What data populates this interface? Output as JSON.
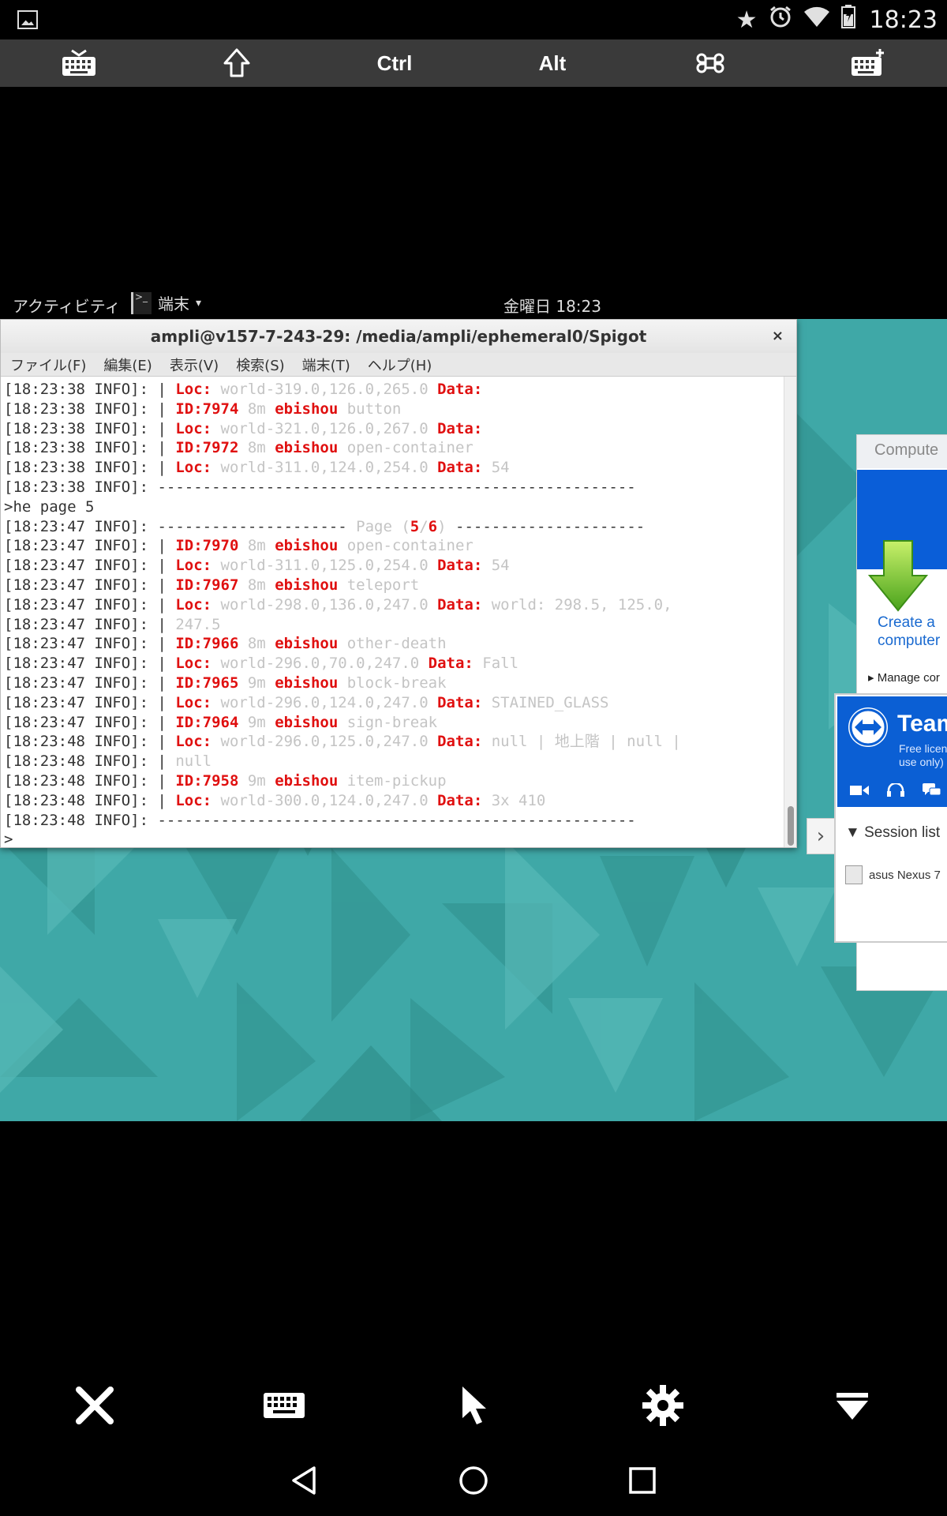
{
  "status_bar": {
    "time": "18:23",
    "icons": [
      "picture-icon",
      "star-icon",
      "alarm-icon",
      "wifi-icon",
      "battery-icon"
    ]
  },
  "toolbar": {
    "keyboard": "keyboard-icon",
    "shift": "shift-icon",
    "ctrl_label": "Ctrl",
    "alt_label": "Alt",
    "cmd": "command-icon",
    "extra_keyboard": "keyboard-plus-icon"
  },
  "gnome_bar": {
    "activities": "アクティビティ",
    "app_name": "端末",
    "app_caret": "▾",
    "datetime": "金曜日 18:23"
  },
  "terminal": {
    "title": "ampli@v157-7-243-29: /media/ampli/ephemeral0/Spigot",
    "close": "×",
    "menu": [
      "ファイル(F)",
      "編集(E)",
      "表示(V)",
      "検索(S)",
      "端末(T)",
      "ヘルプ(H)"
    ],
    "lines": [
      [
        {
          "t": "[18:23:38 INFO]: | "
        },
        {
          "t": "Loc: ",
          "c": "red"
        },
        {
          "t": "world-319.0,126.0,265.0 ",
          "c": "grey"
        },
        {
          "t": "Data:",
          "c": "red"
        }
      ],
      [
        {
          "t": "[18:23:38 INFO]: | "
        },
        {
          "t": "ID:7974 ",
          "c": "red"
        },
        {
          "t": "8m ",
          "c": "grey"
        },
        {
          "t": "ebishou ",
          "c": "red"
        },
        {
          "t": "button",
          "c": "grey"
        }
      ],
      [
        {
          "t": "[18:23:38 INFO]: | "
        },
        {
          "t": "Loc: ",
          "c": "red"
        },
        {
          "t": "world-321.0,126.0,267.0 ",
          "c": "grey"
        },
        {
          "t": "Data:",
          "c": "red"
        }
      ],
      [
        {
          "t": "[18:23:38 INFO]: | "
        },
        {
          "t": "ID:7972 ",
          "c": "red"
        },
        {
          "t": "8m ",
          "c": "grey"
        },
        {
          "t": "ebishou ",
          "c": "red"
        },
        {
          "t": "open-container",
          "c": "grey"
        }
      ],
      [
        {
          "t": "[18:23:38 INFO]: | "
        },
        {
          "t": "Loc: ",
          "c": "red"
        },
        {
          "t": "world-311.0,124.0,254.0 ",
          "c": "grey"
        },
        {
          "t": "Data: ",
          "c": "red"
        },
        {
          "t": "54",
          "c": "grey"
        }
      ],
      [
        {
          "t": "[18:23:38 INFO]: -----------------------------------------------------"
        }
      ],
      [
        {
          "t": ">he page 5"
        }
      ],
      [
        {
          "t": "[18:23:47 INFO]: --------------------- "
        },
        {
          "t": "Page (",
          "c": "grey"
        },
        {
          "t": "5",
          "c": "red"
        },
        {
          "t": "/",
          "c": "grey"
        },
        {
          "t": "6",
          "c": "red"
        },
        {
          "t": ") ",
          "c": "grey"
        },
        {
          "t": "---------------------"
        }
      ],
      [
        {
          "t": "[18:23:47 INFO]: | "
        },
        {
          "t": "ID:7970 ",
          "c": "red"
        },
        {
          "t": "8m ",
          "c": "grey"
        },
        {
          "t": "ebishou ",
          "c": "red"
        },
        {
          "t": "open-container",
          "c": "grey"
        }
      ],
      [
        {
          "t": "[18:23:47 INFO]: | "
        },
        {
          "t": "Loc: ",
          "c": "red"
        },
        {
          "t": "world-311.0,125.0,254.0 ",
          "c": "grey"
        },
        {
          "t": "Data: ",
          "c": "red"
        },
        {
          "t": "54",
          "c": "grey"
        }
      ],
      [
        {
          "t": "[18:23:47 INFO]: | "
        },
        {
          "t": "ID:7967 ",
          "c": "red"
        },
        {
          "t": "8m ",
          "c": "grey"
        },
        {
          "t": "ebishou ",
          "c": "red"
        },
        {
          "t": "teleport",
          "c": "grey"
        }
      ],
      [
        {
          "t": "[18:23:47 INFO]: | "
        },
        {
          "t": "Loc: ",
          "c": "red"
        },
        {
          "t": "world-298.0,136.0,247.0 ",
          "c": "grey"
        },
        {
          "t": "Data: ",
          "c": "red"
        },
        {
          "t": "world: 298.5, 125.0,",
          "c": "grey"
        }
      ],
      [
        {
          "t": "[18:23:47 INFO]: | "
        },
        {
          "t": "247.5",
          "c": "grey"
        }
      ],
      [
        {
          "t": "[18:23:47 INFO]: | "
        },
        {
          "t": "ID:7966 ",
          "c": "red"
        },
        {
          "t": "8m ",
          "c": "grey"
        },
        {
          "t": "ebishou ",
          "c": "red"
        },
        {
          "t": "other-death",
          "c": "grey"
        }
      ],
      [
        {
          "t": "[18:23:47 INFO]: | "
        },
        {
          "t": "Loc: ",
          "c": "red"
        },
        {
          "t": "world-296.0,70.0,247.0 ",
          "c": "grey"
        },
        {
          "t": "Data: ",
          "c": "red"
        },
        {
          "t": "Fall",
          "c": "grey"
        }
      ],
      [
        {
          "t": "[18:23:47 INFO]: | "
        },
        {
          "t": "ID:7965 ",
          "c": "red"
        },
        {
          "t": "9m ",
          "c": "grey"
        },
        {
          "t": "ebishou ",
          "c": "red"
        },
        {
          "t": "block-break",
          "c": "grey"
        }
      ],
      [
        {
          "t": "[18:23:47 INFO]: | "
        },
        {
          "t": "Loc: ",
          "c": "red"
        },
        {
          "t": "world-296.0,124.0,247.0 ",
          "c": "grey"
        },
        {
          "t": "Data: ",
          "c": "red"
        },
        {
          "t": "STAINED_GLASS",
          "c": "grey"
        }
      ],
      [
        {
          "t": "[18:23:47 INFO]: | "
        },
        {
          "t": "ID:7964 ",
          "c": "red"
        },
        {
          "t": "9m ",
          "c": "grey"
        },
        {
          "t": "ebishou ",
          "c": "red"
        },
        {
          "t": "sign-break",
          "c": "grey"
        }
      ],
      [
        {
          "t": "[18:23:48 INFO]: | "
        },
        {
          "t": "Loc: ",
          "c": "red"
        },
        {
          "t": "world-296.0,125.0,247.0 ",
          "c": "grey"
        },
        {
          "t": "Data: ",
          "c": "red"
        },
        {
          "t": "null | 地上階 | null |",
          "c": "grey"
        }
      ],
      [
        {
          "t": "[18:23:48 INFO]: | "
        },
        {
          "t": "null",
          "c": "grey"
        }
      ],
      [
        {
          "t": "[18:23:48 INFO]: | "
        },
        {
          "t": "ID:7958 ",
          "c": "red"
        },
        {
          "t": "9m ",
          "c": "grey"
        },
        {
          "t": "ebishou ",
          "c": "red"
        },
        {
          "t": "item-pickup",
          "c": "grey"
        }
      ],
      [
        {
          "t": "[18:23:48 INFO]: | "
        },
        {
          "t": "Loc: ",
          "c": "red"
        },
        {
          "t": "world-300.0,124.0,247.0 ",
          "c": "grey"
        },
        {
          "t": "Data: ",
          "c": "red"
        },
        {
          "t": "3x 410",
          "c": "grey"
        }
      ],
      [
        {
          "t": "[18:23:48 INFO]: -----------------------------------------------------"
        }
      ],
      [
        {
          "t": ">"
        }
      ]
    ]
  },
  "teamviewer_back": {
    "header": "Compute",
    "create_line1": "Create a",
    "create_line2": "computer",
    "manage": "▸ Manage cor"
  },
  "teamviewer_front": {
    "title": "Team",
    "sub_line1": "Free licen",
    "sub_line2": "use only)",
    "session_list": "▼ Session list",
    "device": "asus Nexus 7",
    "tab": "›"
  },
  "bottom_bar": [
    "close-icon",
    "keyboard-icon",
    "pointer-icon",
    "settings-icon",
    "collapse-icon"
  ],
  "nav_bar": [
    "back-icon",
    "home-icon",
    "recents-icon"
  ],
  "colors": {
    "desktop": "#3fa8a7",
    "terminal_red": "#e01010",
    "teamviewer_blue": "#0b5fd4"
  }
}
